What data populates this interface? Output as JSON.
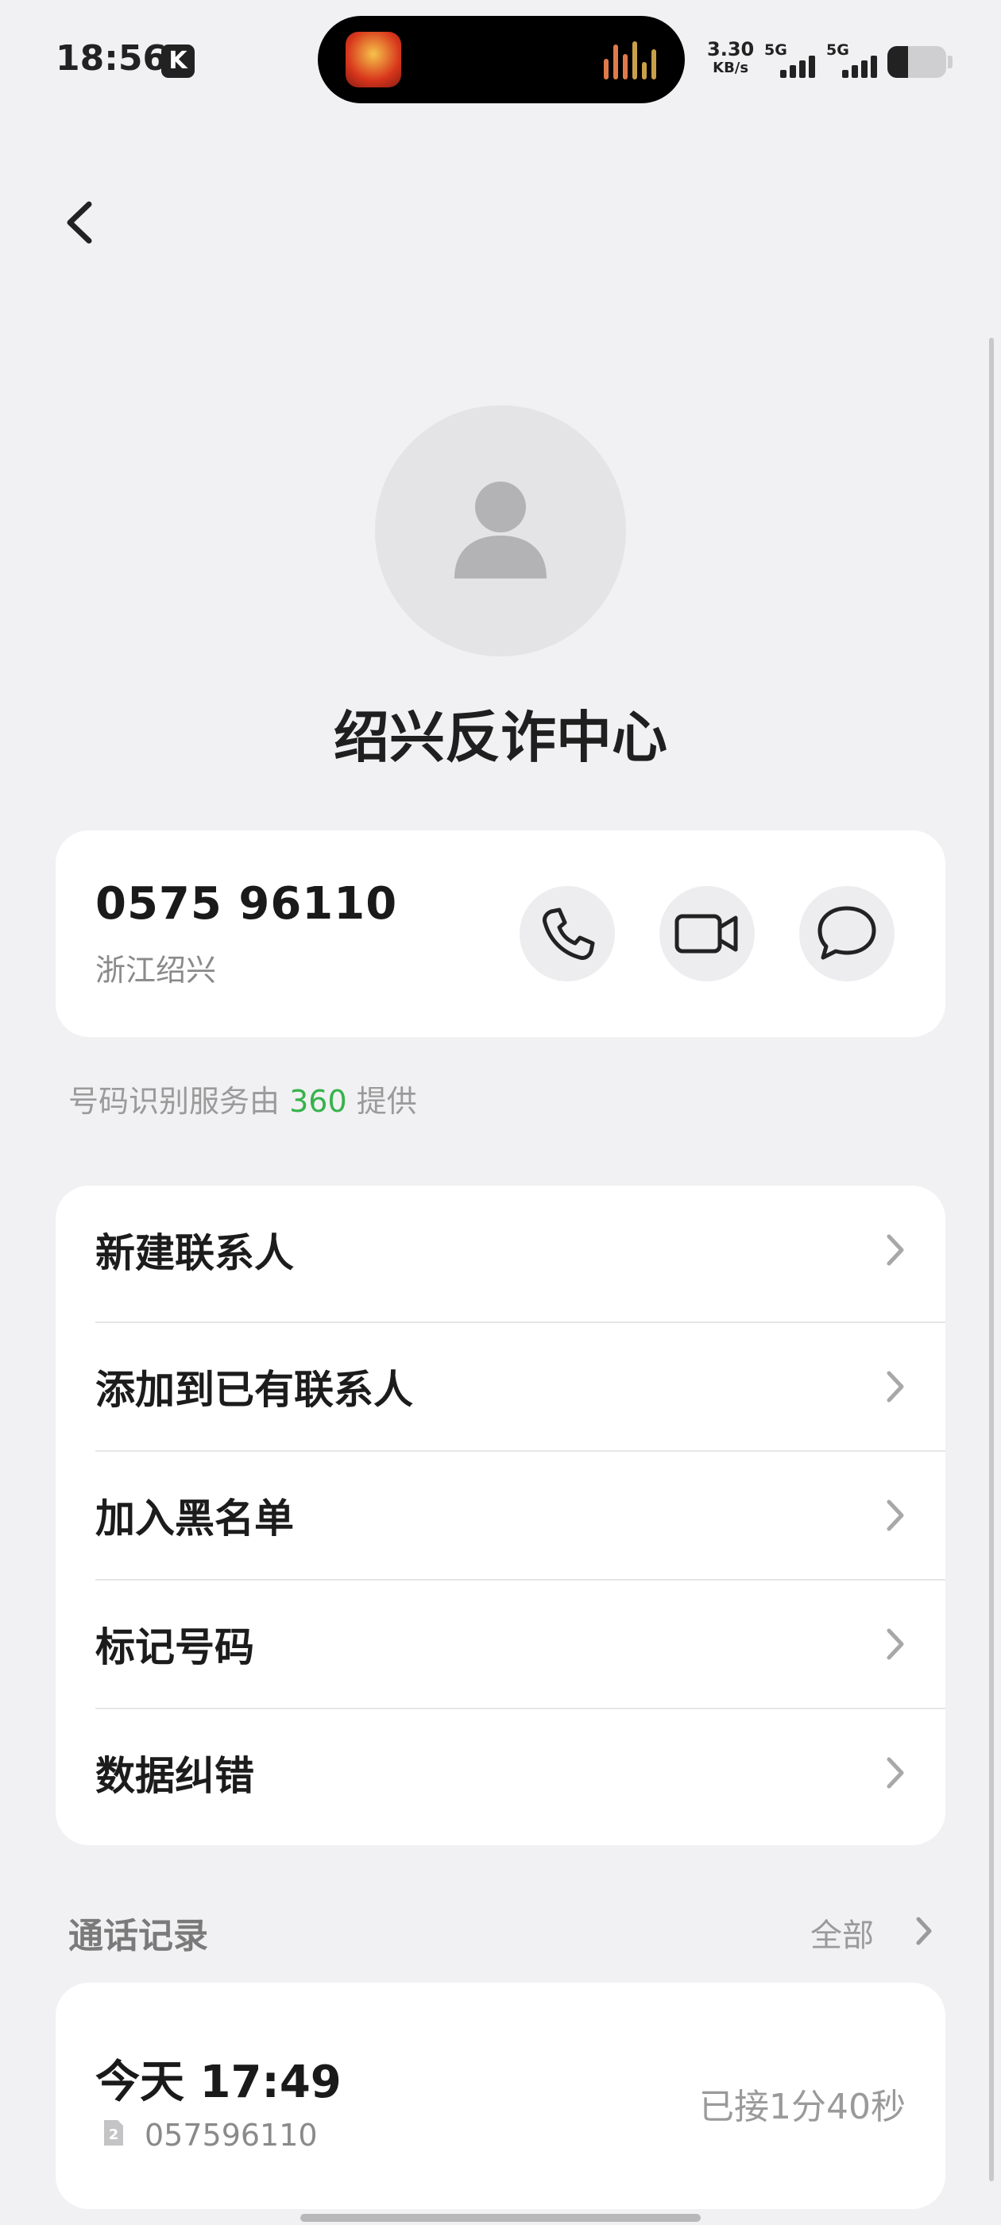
{
  "status_bar": {
    "time": "18:56",
    "app_badge": "K",
    "net_speed_value": "3.30",
    "net_speed_unit": "KB/s",
    "sim1_type": "5G",
    "sim2_type": "5G"
  },
  "contact": {
    "name": "绍兴反诈中心",
    "number": "0575 96110",
    "location": "浙江绍兴"
  },
  "actions": {
    "call_icon": "phone-icon",
    "video_icon": "video-camera-icon",
    "message_icon": "message-bubble-icon"
  },
  "provider": {
    "prefix": "号码识别服务由",
    "brand": "360",
    "suffix": "提供",
    "brand_color": "#35b34a"
  },
  "menu": {
    "items": [
      {
        "label": "新建联系人"
      },
      {
        "label": "添加到已有联系人"
      },
      {
        "label": "加入黑名单"
      },
      {
        "label": "标记号码"
      },
      {
        "label": "数据纠错"
      }
    ]
  },
  "call_log": {
    "title": "通话记录",
    "view_all": "全部",
    "records": [
      {
        "time": "今天 17:49",
        "sim": "2",
        "number": "057596110",
        "status": "已接1分40秒"
      }
    ]
  }
}
